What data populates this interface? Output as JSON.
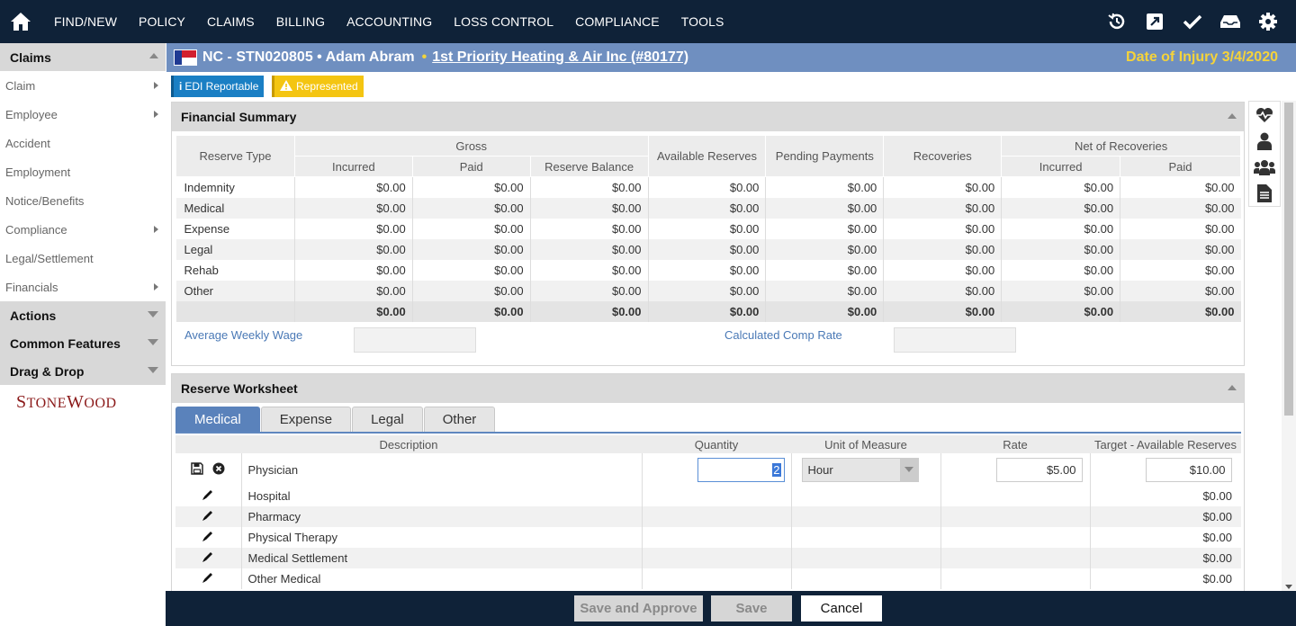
{
  "nav": {
    "items": [
      "FIND/NEW",
      "POLICY",
      "CLAIMS",
      "BILLING",
      "ACCOUNTING",
      "LOSS CONTROL",
      "COMPLIANCE",
      "TOOLS"
    ],
    "right_icons": [
      "history-icon",
      "external-link-icon",
      "check-icon",
      "inbox-icon",
      "gear-icon"
    ]
  },
  "sidebar": {
    "section_title": "Claims",
    "items": [
      {
        "label": "Claim",
        "has_submenu": true
      },
      {
        "label": "Employee",
        "has_submenu": true
      },
      {
        "label": "Accident",
        "has_submenu": false
      },
      {
        "label": "Employment",
        "has_submenu": false
      },
      {
        "label": "Notice/Benefits",
        "has_submenu": false
      },
      {
        "label": "Compliance",
        "has_submenu": true
      },
      {
        "label": "Legal/Settlement",
        "has_submenu": false
      },
      {
        "label": "Financials",
        "has_submenu": true
      }
    ],
    "sections": [
      "Actions",
      "Common Features",
      "Drag & Drop"
    ],
    "logo_first": "S",
    "logo_rest": "TONE",
    "logo_w": "W",
    "logo_end": "OOD"
  },
  "claim": {
    "title": "NC - STN020805 • Adam Abram",
    "dot": "•",
    "employer_link": "1st Priority Heating & Air Inc (#80177)",
    "doi_label": "Date of Injury",
    "doi_value": "3/4/2020"
  },
  "badges": {
    "edi": "EDI Reportable",
    "represented": "Represented"
  },
  "financial_summary": {
    "title": "Financial Summary",
    "headers": {
      "reserve_type": "Reserve Type",
      "gross": "Gross",
      "incurred": "Incurred",
      "paid": "Paid",
      "reserve_balance": "Reserve Balance",
      "available_reserves": "Available Reserves",
      "pending_payments": "Pending Payments",
      "recoveries": "Recoveries",
      "net_of_recoveries": "Net of Recoveries",
      "net_incurred": "Incurred",
      "net_paid": "Paid"
    },
    "rows": [
      {
        "type": "Indemnity",
        "values": [
          "$0.00",
          "$0.00",
          "$0.00",
          "$0.00",
          "$0.00",
          "$0.00",
          "$0.00",
          "$0.00"
        ]
      },
      {
        "type": "Medical",
        "values": [
          "$0.00",
          "$0.00",
          "$0.00",
          "$0.00",
          "$0.00",
          "$0.00",
          "$0.00",
          "$0.00"
        ]
      },
      {
        "type": "Expense",
        "values": [
          "$0.00",
          "$0.00",
          "$0.00",
          "$0.00",
          "$0.00",
          "$0.00",
          "$0.00",
          "$0.00"
        ]
      },
      {
        "type": "Legal",
        "values": [
          "$0.00",
          "$0.00",
          "$0.00",
          "$0.00",
          "$0.00",
          "$0.00",
          "$0.00",
          "$0.00"
        ]
      },
      {
        "type": "Rehab",
        "values": [
          "$0.00",
          "$0.00",
          "$0.00",
          "$0.00",
          "$0.00",
          "$0.00",
          "$0.00",
          "$0.00"
        ]
      },
      {
        "type": "Other",
        "values": [
          "$0.00",
          "$0.00",
          "$0.00",
          "$0.00",
          "$0.00",
          "$0.00",
          "$0.00",
          "$0.00"
        ]
      }
    ],
    "totals": [
      "$0.00",
      "$0.00",
      "$0.00",
      "$0.00",
      "$0.00",
      "$0.00",
      "$0.00",
      "$0.00"
    ],
    "average_weekly_wage_label": "Average Weekly Wage",
    "average_weekly_wage_value": "",
    "calculated_comp_rate_label": "Calculated Comp Rate",
    "calculated_comp_rate_value": ""
  },
  "reserve_worksheet": {
    "title": "Reserve Worksheet",
    "tabs": [
      "Medical",
      "Expense",
      "Legal",
      "Other"
    ],
    "active_tab": "Medical",
    "headers": {
      "description": "Description",
      "quantity": "Quantity",
      "unit_of_measure": "Unit of Measure",
      "rate": "Rate",
      "target": "Target - Available Reserves"
    },
    "editing_row": {
      "description": "Physician",
      "quantity": "2",
      "unit_of_measure": "Hour",
      "rate": "$5.00",
      "target": "$10.00"
    },
    "rows": [
      {
        "description": "Hospital",
        "target": "$0.00"
      },
      {
        "description": "Pharmacy",
        "target": "$0.00"
      },
      {
        "description": "Physical Therapy",
        "target": "$0.00"
      },
      {
        "description": "Medical Settlement",
        "target": "$0.00"
      },
      {
        "description": "Other Medical",
        "target": "$0.00"
      }
    ]
  },
  "footer": {
    "save_and_approve": "Save and Approve",
    "save": "Save",
    "cancel": "Cancel"
  }
}
